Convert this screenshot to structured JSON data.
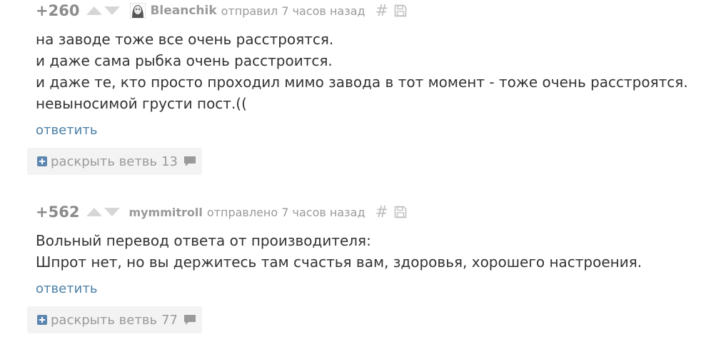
{
  "comments": [
    {
      "rating": "+260",
      "author": "Bleanchik",
      "time": "отправил 7 часов назад",
      "hash": "#",
      "lines": [
        "на заводе тоже все очень расстроятся.",
        "и даже сама рыбка очень расстроится.",
        "и даже те, кто просто проходил мимо завода в тот момент - тоже очень расстроятся.",
        "невыносимой грусти пост.(("
      ],
      "reply_label": "ответить",
      "branch_label": "раскрыть ветвь",
      "branch_count": "13"
    },
    {
      "rating": "+562",
      "author": "mymmitroll",
      "time": "отправлено 7 часов назад",
      "hash": "#",
      "lines": [
        "Вольный перевод ответа от производителя:",
        "Шпрот нет, но вы держитесь там счастья вам, здоровья, хорошего настроения."
      ],
      "reply_label": "ответить",
      "branch_label": "раскрыть ветвь",
      "branch_count": "77"
    }
  ],
  "icons": {
    "vote_up": "triangle-up-icon",
    "vote_down": "triangle-down-icon",
    "save": "floppy-disk-icon",
    "expand": "plus-square-icon",
    "comments": "speech-bubble-icon"
  },
  "colors": {
    "link": "#4a7fa7",
    "expand_icon": "#5c86b0",
    "muted": "#999999",
    "branch_bg": "#f3f3f3"
  }
}
